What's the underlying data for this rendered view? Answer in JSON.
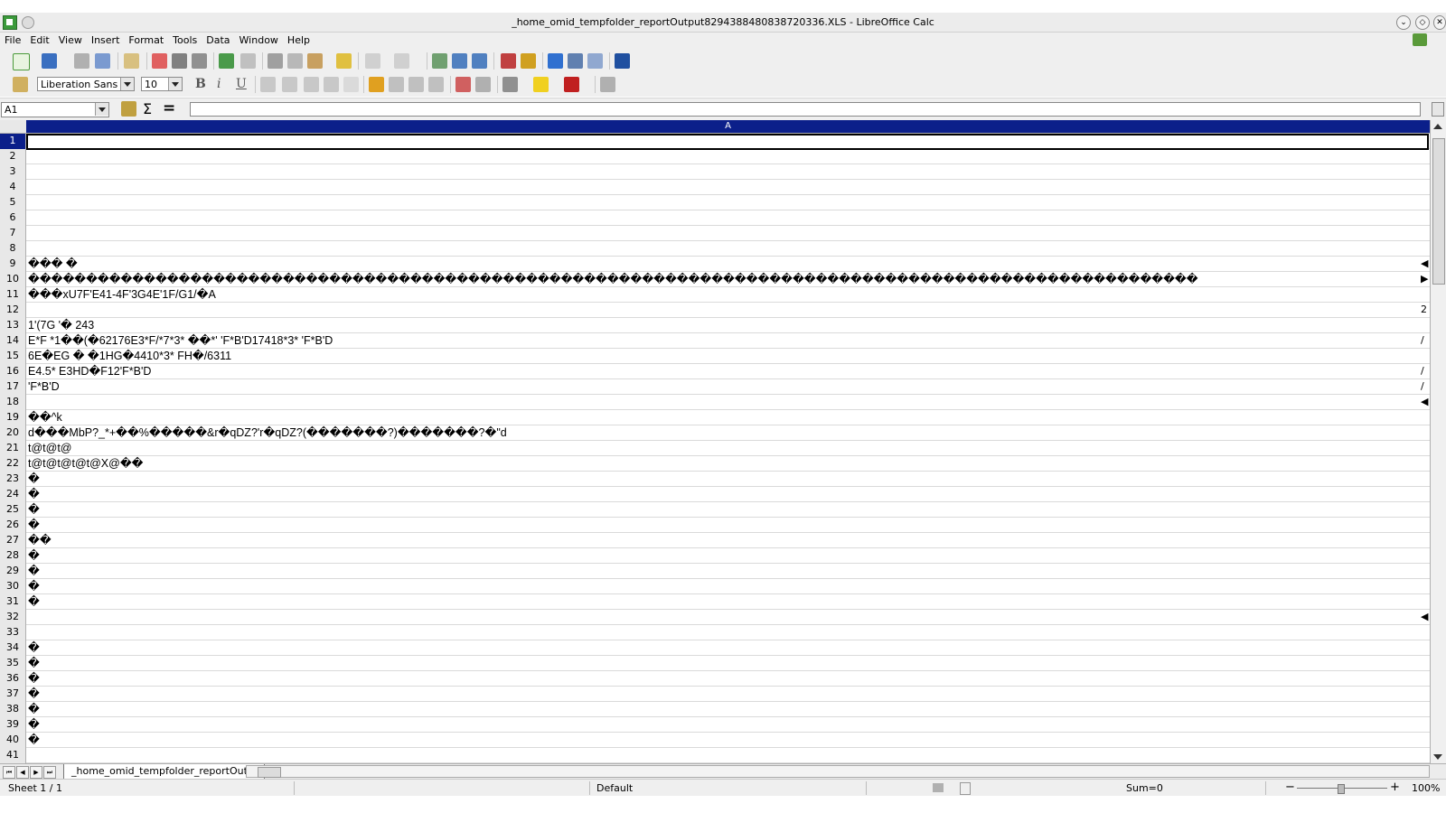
{
  "window": {
    "title": "_home_omid_tempfolder_reportOutput8294388480838720336.XLS - LibreOffice Calc"
  },
  "menu": [
    "File",
    "Edit",
    "View",
    "Insert",
    "Format",
    "Tools",
    "Data",
    "Window",
    "Help"
  ],
  "formatting": {
    "font_name": "Liberation Sans",
    "font_size": "10"
  },
  "formula_bar": {
    "name_box": "A1",
    "content": ""
  },
  "column_header": "A",
  "rows": [
    {
      "num": "1",
      "text": ""
    },
    {
      "num": "2",
      "text": ""
    },
    {
      "num": "3",
      "text": ""
    },
    {
      "num": "4",
      "text": ""
    },
    {
      "num": "5",
      "text": ""
    },
    {
      "num": "6",
      "text": ""
    },
    {
      "num": "7",
      "text": ""
    },
    {
      "num": "8",
      "text": ""
    },
    {
      "num": "9",
      "text": "��� �"
    },
    {
      "num": "10",
      "text": "�����������������������������������������������������������������������������������������������������"
    },
    {
      "num": "11",
      "text": "���xU7F'E41-4F'3G4E'1F/G1/�A"
    },
    {
      "num": "12",
      "text": ""
    },
    {
      "num": "13",
      "text": "1'(7G '� 243"
    },
    {
      "num": "14",
      "text": "E*F *1��(�62176E3*F/*7*3* ��*' 'F*B'D17418*3* 'F*B'D"
    },
    {
      "num": "15",
      "text": "6E�EG � �1HG�4410*3* FH�/6311"
    },
    {
      "num": "16",
      "text": "E4.5* E3HD�F12'F*B'D"
    },
    {
      "num": "17",
      "text": "'F*B'D"
    },
    {
      "num": "18",
      "text": ""
    },
    {
      "num": "19",
      "text": "��^k"
    },
    {
      "num": "20",
      "text": "d���MbP?_*+��%�����&r�qDZ?'r�qDZ?(�������?)�������?�\"d"
    },
    {
      "num": "21",
      "text": "t@t@t@"
    },
    {
      "num": "22",
      "text": "t@t@t@t@t@X@��"
    },
    {
      "num": "23",
      "text": "�"
    },
    {
      "num": "24",
      "text": "�"
    },
    {
      "num": "25",
      "text": "�"
    },
    {
      "num": "26",
      "text": "�"
    },
    {
      "num": "27",
      "text": "��"
    },
    {
      "num": "28",
      "text": "�"
    },
    {
      "num": "29",
      "text": "�"
    },
    {
      "num": "30",
      "text": "�"
    },
    {
      "num": "31",
      "text": "�"
    },
    {
      "num": "32",
      "text": ""
    },
    {
      "num": "33",
      "text": ""
    },
    {
      "num": "34",
      "text": "�"
    },
    {
      "num": "35",
      "text": "�"
    },
    {
      "num": "36",
      "text": "�"
    },
    {
      "num": "37",
      "text": "�"
    },
    {
      "num": "38",
      "text": "�"
    },
    {
      "num": "39",
      "text": "�"
    },
    {
      "num": "40",
      "text": "�"
    },
    {
      "num": "41",
      "text": ""
    }
  ],
  "overflow_marks": {
    "9": "◀",
    "10": "▶",
    "12": "2",
    "14": "/",
    "16": "/",
    "17": "/",
    "18": "◀",
    "32": "◀"
  },
  "sheet_tab": "_home_omid_tempfolder_reportOut...",
  "status": {
    "sheet": "Sheet 1 / 1",
    "style": "Default",
    "sum": "Sum=0",
    "zoom": "100%"
  }
}
